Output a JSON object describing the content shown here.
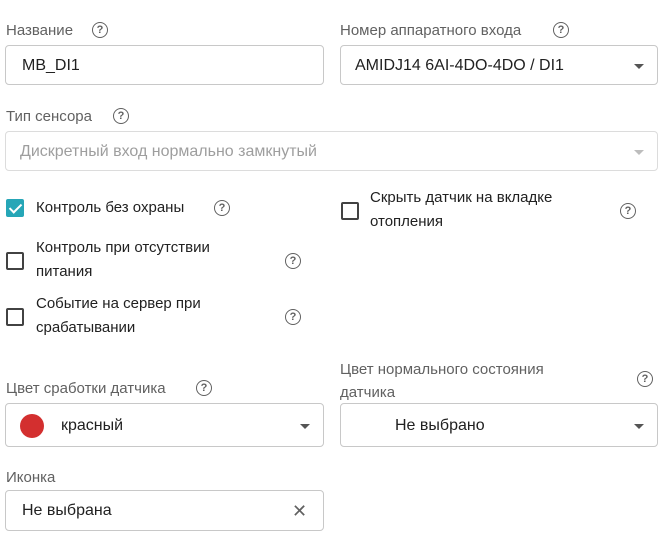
{
  "name_field": {
    "label": "Название",
    "value": "MB_DI1"
  },
  "hw_input": {
    "label": "Номер аппаратного входа",
    "value": "AMIDJ14 6AI-4DO-4DO / DI1"
  },
  "sensor_type": {
    "label": "Тип сенсора",
    "value": "Дискретный вход нормально замкнутый"
  },
  "checkboxes": {
    "control_without_guard": {
      "label": "Контроль без охраны",
      "checked": true
    },
    "hide_heating": {
      "label": "Скрыть датчик на вкладке отопления",
      "checked": false
    },
    "control_power_loss": {
      "label": "Контроль при отсутствии питания",
      "checked": false
    },
    "event_to_server": {
      "label": "Событие на сервер при срабатывании",
      "checked": false
    }
  },
  "trigger_color": {
    "label": "Цвет сработки датчика",
    "value": "красный",
    "swatch": "#d32f2f"
  },
  "normal_color": {
    "label": "Цвет нормального состояния датчика",
    "value": "Не выбрано"
  },
  "icon_field": {
    "label": "Иконка",
    "value": "Не выбрана"
  },
  "icons": {
    "help": "?",
    "clear": "✕"
  },
  "colors": {
    "accent": "#26a6b7",
    "border": "#c8c8c8"
  }
}
